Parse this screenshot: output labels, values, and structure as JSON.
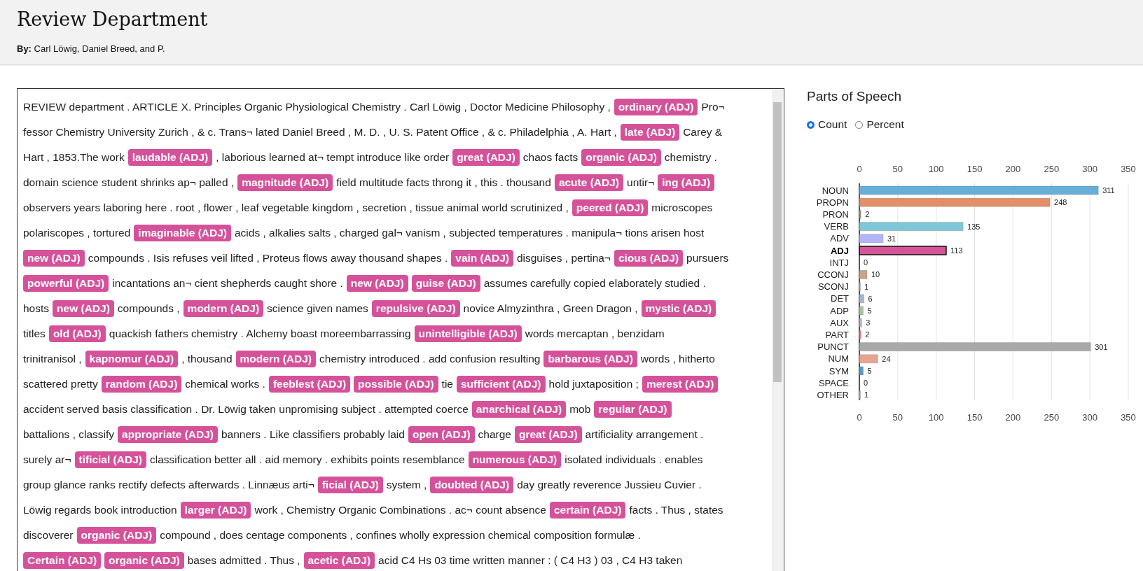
{
  "header": {
    "title": "Review Department",
    "byline": "**By:** Carl Löwig, Daniel Breed, and P."
  },
  "document": {
    "lines": [
      [
        {
          "kind": "plain",
          "text": "REVIEW department . ARTICLE X. Principles Organic Physiological Chemistry . Carl Löwig , Doctor Medicine Philosophy ,"
        },
        {
          "kind": "tag",
          "text": "ordinary (ADJ)"
        },
        {
          "kind": "plain",
          "text": "Pro¬"
        }
      ],
      [
        {
          "kind": "plain",
          "text": "fessor Chemistry University Zurich , & c. Trans¬ lated Daniel Breed , M. D. , U. S. Patent Office , & c. Philadelphia , A. Hart ,"
        },
        {
          "kind": "tag",
          "text": "late (ADJ)"
        },
        {
          "kind": "plain",
          "text": "Carey &"
        }
      ],
      [
        {
          "kind": "plain",
          "text": "Hart , 1853.The work"
        },
        {
          "kind": "tag",
          "text": "laudable (ADJ)"
        },
        {
          "kind": "plain",
          "text": ", laborious learned at¬ tempt introduce like order"
        },
        {
          "kind": "tag",
          "text": "great (ADJ)"
        },
        {
          "kind": "plain",
          "text": "chaos facts"
        },
        {
          "kind": "tag",
          "text": "organic (ADJ)"
        },
        {
          "kind": "plain",
          "text": "chemistry ."
        }
      ],
      [
        {
          "kind": "plain",
          "text": "domain science student shrinks ap¬ palled ,"
        },
        {
          "kind": "tag",
          "text": "magnitude (ADJ)"
        },
        {
          "kind": "plain",
          "text": "field multitude facts throng it , this . thousand"
        },
        {
          "kind": "tag",
          "text": "acute (ADJ)"
        },
        {
          "kind": "plain",
          "text": "untir¬"
        },
        {
          "kind": "tag",
          "text": "ing (ADJ)"
        }
      ],
      [
        {
          "kind": "plain",
          "text": "observers years laboring here . root , flower , leaf vegetable kingdom , secretion , tissue animal world scrutinized ,"
        },
        {
          "kind": "tag",
          "text": "peered (ADJ)"
        },
        {
          "kind": "plain",
          "text": "microscopes"
        }
      ],
      [
        {
          "kind": "plain",
          "text": "polariscopes , tortured"
        },
        {
          "kind": "tag",
          "text": "imaginable (ADJ)"
        },
        {
          "kind": "plain",
          "text": "acids , alkalies salts , charged gal¬ vanism , subjected temperatures . manipula¬ tions arisen host"
        }
      ],
      [
        {
          "kind": "tag",
          "text": "new (ADJ)"
        },
        {
          "kind": "plain",
          "text": "compounds . Isis refuses veil lifted , Proteus flows away thousand shapes ."
        },
        {
          "kind": "tag",
          "text": "vain (ADJ)"
        },
        {
          "kind": "plain",
          "text": "disguises , pertina¬"
        },
        {
          "kind": "tag",
          "text": "cious (ADJ)"
        },
        {
          "kind": "plain",
          "text": "pursuers"
        }
      ],
      [
        {
          "kind": "tag",
          "text": "powerful (ADJ)"
        },
        {
          "kind": "plain",
          "text": "incantations an¬ cient shepherds caught shore ."
        },
        {
          "kind": "tag",
          "text": "new (ADJ)"
        },
        {
          "kind": "tag",
          "text": "guise (ADJ)"
        },
        {
          "kind": "plain",
          "text": "assumes carefully copied elaborately studied ."
        }
      ],
      [
        {
          "kind": "plain",
          "text": "hosts"
        },
        {
          "kind": "tag",
          "text": "new (ADJ)"
        },
        {
          "kind": "plain",
          "text": "compounds ,"
        },
        {
          "kind": "tag",
          "text": "modern (ADJ)"
        },
        {
          "kind": "plain",
          "text": "science given names"
        },
        {
          "kind": "tag",
          "text": "repulsive (ADJ)"
        },
        {
          "kind": "plain",
          "text": "novice Almyzinthra , Green Dragon ,"
        },
        {
          "kind": "tag",
          "text": "mystic (ADJ)"
        }
      ],
      [
        {
          "kind": "plain",
          "text": "titles"
        },
        {
          "kind": "tag",
          "text": "old (ADJ)"
        },
        {
          "kind": "plain",
          "text": "quackish fathers chemistry . Alchemy boast moreembarrassing"
        },
        {
          "kind": "tag",
          "text": "unintelligible (ADJ)"
        },
        {
          "kind": "plain",
          "text": "words mercaptan , benzidam"
        }
      ],
      [
        {
          "kind": "plain",
          "text": "trinitranisol ,"
        },
        {
          "kind": "tag",
          "text": "kapnomur (ADJ)"
        },
        {
          "kind": "plain",
          "text": ", thousand"
        },
        {
          "kind": "tag",
          "text": "modern (ADJ)"
        },
        {
          "kind": "plain",
          "text": "chemistry introduced . add confusion resulting"
        },
        {
          "kind": "tag",
          "text": "barbarous (ADJ)"
        },
        {
          "kind": "plain",
          "text": "words , hitherto"
        }
      ],
      [
        {
          "kind": "plain",
          "text": "scattered pretty"
        },
        {
          "kind": "tag",
          "text": "random (ADJ)"
        },
        {
          "kind": "plain",
          "text": "chemical works ."
        },
        {
          "kind": "tag",
          "text": "feeblest (ADJ)"
        },
        {
          "kind": "tag",
          "text": "possible (ADJ)"
        },
        {
          "kind": "plain",
          "text": "tie"
        },
        {
          "kind": "tag",
          "text": "sufficient (ADJ)"
        },
        {
          "kind": "plain",
          "text": "hold juxtaposition ;"
        },
        {
          "kind": "tag",
          "text": "merest (ADJ)"
        }
      ],
      [
        {
          "kind": "plain",
          "text": "accident served basis classification . Dr. Löwig taken unpromising subject . attempted coerce"
        },
        {
          "kind": "tag",
          "text": "anarchical (ADJ)"
        },
        {
          "kind": "plain",
          "text": "mob"
        },
        {
          "kind": "tag",
          "text": "regular (ADJ)"
        }
      ],
      [
        {
          "kind": "plain",
          "text": "battalions , classify"
        },
        {
          "kind": "tag",
          "text": "appropriate (ADJ)"
        },
        {
          "kind": "plain",
          "text": "banners . Like classifiers probably laid"
        },
        {
          "kind": "tag",
          "text": "open (ADJ)"
        },
        {
          "kind": "plain",
          "text": "charge"
        },
        {
          "kind": "tag",
          "text": "great (ADJ)"
        },
        {
          "kind": "plain",
          "text": "artificiality arrangement ."
        }
      ],
      [
        {
          "kind": "plain",
          "text": "surely ar¬"
        },
        {
          "kind": "tag",
          "text": "tificial (ADJ)"
        },
        {
          "kind": "plain",
          "text": "classification better all . aid memory . exhibits points resemblance"
        },
        {
          "kind": "tag",
          "text": "numerous (ADJ)"
        },
        {
          "kind": "plain",
          "text": "isolated individuals . enables"
        }
      ],
      [
        {
          "kind": "plain",
          "text": "group glance ranks rectify defects afterwards . Linnæus arti¬"
        },
        {
          "kind": "tag",
          "text": "ficial (ADJ)"
        },
        {
          "kind": "plain",
          "text": "system ,"
        },
        {
          "kind": "tag",
          "text": "doubted (ADJ)"
        },
        {
          "kind": "plain",
          "text": "day greatly reverence Jussieu Cuvier ."
        }
      ],
      [
        {
          "kind": "plain",
          "text": "Löwig regards book introduction"
        },
        {
          "kind": "tag",
          "text": "larger (ADJ)"
        },
        {
          "kind": "plain",
          "text": "work , Chemistry Organic Combinations . ac¬ count absence"
        },
        {
          "kind": "tag",
          "text": "certain (ADJ)"
        },
        {
          "kind": "plain",
          "text": "facts . Thus , states"
        }
      ],
      [
        {
          "kind": "plain",
          "text": "discoverer"
        },
        {
          "kind": "tag",
          "text": "organic (ADJ)"
        },
        {
          "kind": "plain",
          "text": "compound , does centage components , confines wholly expression chemical composition formulæ ."
        }
      ],
      [
        {
          "kind": "tag",
          "text": "Certain (ADJ)"
        },
        {
          "kind": "tag",
          "text": "organic (ADJ)"
        },
        {
          "kind": "plain",
          "text": "bases admitted . Thus ,"
        },
        {
          "kind": "tag",
          "text": "acetic (ADJ)"
        },
        {
          "kind": "plain",
          "text": "acid C4 Hs 03 time written manner : ( C4 H3 ) 03 , C4 H3 taken"
        }
      ]
    ]
  },
  "pos_panel": {
    "title": "Parts of Speech",
    "modes": [
      {
        "label": "Count",
        "selected": true
      },
      {
        "label": "Percent",
        "selected": false
      }
    ],
    "chart_data": {
      "type": "bar",
      "orientation": "horizontal",
      "categories": [
        "NOUN",
        "PROPN",
        "PRON",
        "VERB",
        "ADV",
        "ADJ",
        "INTJ",
        "CCONJ",
        "SCONJ",
        "DET",
        "ADP",
        "AUX",
        "PART",
        "PUNCT",
        "NUM",
        "SYM",
        "SPACE",
        "OTHER"
      ],
      "values": [
        311,
        248,
        2,
        135,
        31,
        113,
        0,
        10,
        1,
        6,
        5,
        3,
        2,
        301,
        24,
        5,
        0,
        1
      ],
      "xlim": [
        0,
        350
      ],
      "xticks": [
        0,
        50,
        100,
        150,
        200,
        250,
        300,
        350
      ],
      "grid": true,
      "data_labels": true
    },
    "bottom_ticks": [
      "0",
      "50",
      "100",
      "150",
      "200",
      "250",
      "300",
      "350"
    ],
    "bar_styles": [
      {
        "color": "#67aed8",
        "selected": false
      },
      {
        "color": "#e48f6a",
        "selected": false
      },
      {
        "color": "#8fa58a",
        "selected": false
      },
      {
        "color": "#7fc7d6",
        "selected": false
      },
      {
        "color": "#b3b5fb",
        "selected": false
      },
      {
        "color": "#d4549a",
        "selected": true
      },
      {
        "selected": false
      },
      {
        "color": "#c9a38a",
        "selected": false
      },
      {
        "color": "#bbbbbb",
        "selected": false
      },
      {
        "color": "#a3b8d0",
        "selected": false
      },
      {
        "color": "#a8c3a0",
        "selected": false
      },
      {
        "color": "#c0a8d0",
        "selected": false
      },
      {
        "color": "#f07a8a",
        "selected": false
      },
      {
        "color": "#a9a9a9",
        "selected": false
      },
      {
        "color": "#e6a590",
        "selected": false
      },
      {
        "color": "#5a9bc8",
        "selected": false
      },
      {
        "selected": false
      },
      {
        "color": "#bbbbbb",
        "selected": false
      }
    ]
  }
}
